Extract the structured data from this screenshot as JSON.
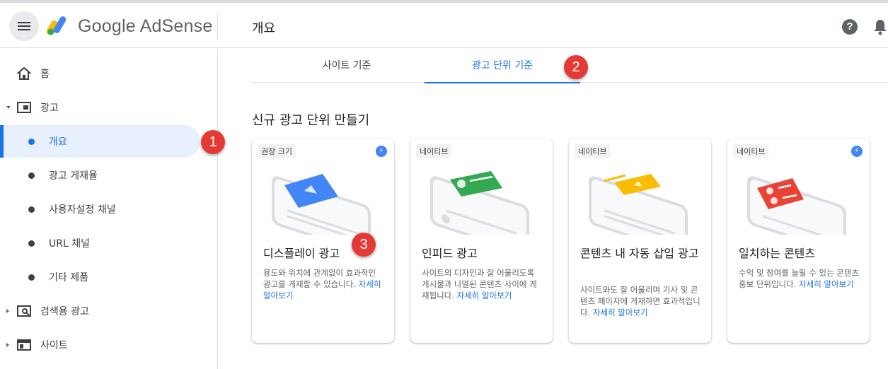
{
  "header": {
    "brand": "Google AdSense",
    "page_title": "개요",
    "help_glyph": "?"
  },
  "sidebar": {
    "items": [
      {
        "label": "홈"
      },
      {
        "label": "광고"
      },
      {
        "label": "개요"
      },
      {
        "label": "광고 게재율"
      },
      {
        "label": "사용자설정 채널"
      },
      {
        "label": "URL 채널"
      },
      {
        "label": "기타 제품"
      },
      {
        "label": "검색용 광고"
      },
      {
        "label": "사이트"
      }
    ]
  },
  "tabs": [
    {
      "label": "사이트 기준"
    },
    {
      "label": "광고 단위 기준"
    }
  ],
  "section_title": "신규 광고 단위 만들기",
  "cards": [
    {
      "tag": "권장 크기",
      "title": "디스플레이 광고",
      "desc": "용도와 위치에 관계없이 효과적인 광고를 게재할 수 있습니다. ",
      "link": "자세히 알아보기",
      "accent": "#4285f4"
    },
    {
      "tag": "네이티브",
      "title": "인피드 광고",
      "desc": "사이트의 디자인과 잘 어울리도록 게시물과 나열된 콘텐츠 사이에 게재됩니다. ",
      "link": "자세히 알아보기",
      "accent": "#34a853"
    },
    {
      "tag": "네이티브",
      "title": "콘텐츠 내 자동 삽입 광고",
      "desc": "사이트와도 잘 어울리며 기사 및 콘텐츠 페이지에 게재하면 효과적입니다. ",
      "link": "자세히 알아보기",
      "accent": "#fbbc04"
    },
    {
      "tag": "네이티브",
      "title": "일치하는 콘텐츠",
      "desc": "수익 및 참여를 늘릴 수 있는 콘텐츠 홍보 단위입니다. ",
      "link": "자세히 알아보기",
      "accent": "#ea4335"
    }
  ],
  "badges": [
    "1",
    "2",
    "3"
  ],
  "colors": {
    "accent": "#1a73e8",
    "badge": "#e53935"
  }
}
